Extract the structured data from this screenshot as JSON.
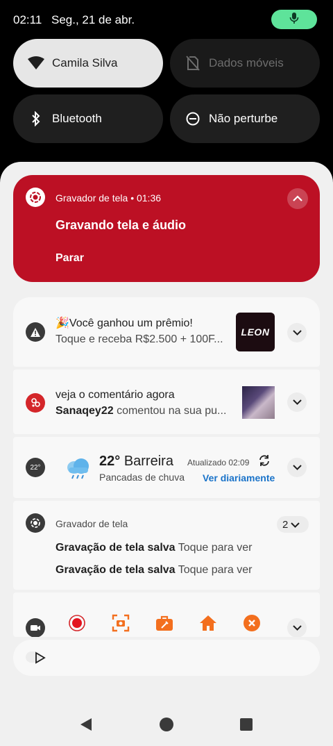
{
  "status_bar": {
    "time": "02:11",
    "date": "Seg., 21 de abr."
  },
  "quick_tiles": {
    "wifi": "Camila Silva",
    "mobile_data": "Dados móveis",
    "bluetooth": "Bluetooth",
    "dnd": "Não perturbe"
  },
  "recording": {
    "app": "Gravador de tela",
    "time": "01:36",
    "title": "Gravando tela e áudio",
    "action": "Parar"
  },
  "notifications": {
    "prize": {
      "title": "🎉Você ganhou um prêmio!",
      "text": "Toque e receba R$2.500 + 100F...",
      "thumb_text": "LEON"
    },
    "comment": {
      "title": "veja o comentário agora",
      "user": "Sanaqey22",
      "text": "comentou na sua pu..."
    },
    "weather": {
      "badge": "22°",
      "temp": "22°",
      "place": "Barreira",
      "updated": "Atualizado 02:09",
      "desc": "Pancadas de chuva",
      "link": "Ver diariamente"
    },
    "saved": {
      "app": "Gravador de tela",
      "count": "2",
      "line1_bold": "Gravação de tela salva",
      "line1_text": "Toque para ver",
      "line2_bold": "Gravação de tela salva",
      "line2_text": "Toque para ver"
    }
  },
  "colors": {
    "recording_bg": "#bc1024",
    "mic_pill": "#5ee39a",
    "accent_orange": "#f36f1e",
    "link_blue": "#1a73c9"
  }
}
